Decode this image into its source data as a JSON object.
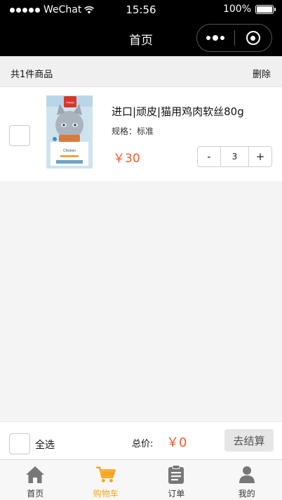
{
  "status_bar": {
    "carrier": "WeChat",
    "time": "15:56",
    "battery": "100%",
    "battery_level": 1.0
  },
  "nav": {
    "title": "首页"
  },
  "cart": {
    "count_label": "共1件商品",
    "delete_label": "删除",
    "items": [
      {
        "title": "进口|顽皮|猫用鸡肉软丝80g",
        "spec": "规格：标准",
        "price": "￥30",
        "quantity": "3",
        "package_brand": "Happy",
        "package_product": "Chicken"
      }
    ]
  },
  "checkout": {
    "select_all_label": "全选",
    "total_label": "总价:",
    "total_value": "￥0",
    "button_label": "去结算"
  },
  "tabbar": {
    "active_color": "#f5a623",
    "tabs": [
      {
        "label": "首页",
        "icon": "home-icon"
      },
      {
        "label": "购物车",
        "icon": "cart-icon",
        "active": true
      },
      {
        "label": "订单",
        "icon": "clipboard-icon"
      },
      {
        "label": "我的",
        "icon": "user-icon"
      }
    ]
  },
  "colors": {
    "price": "#f45c2c",
    "accent": "#f5a623"
  }
}
